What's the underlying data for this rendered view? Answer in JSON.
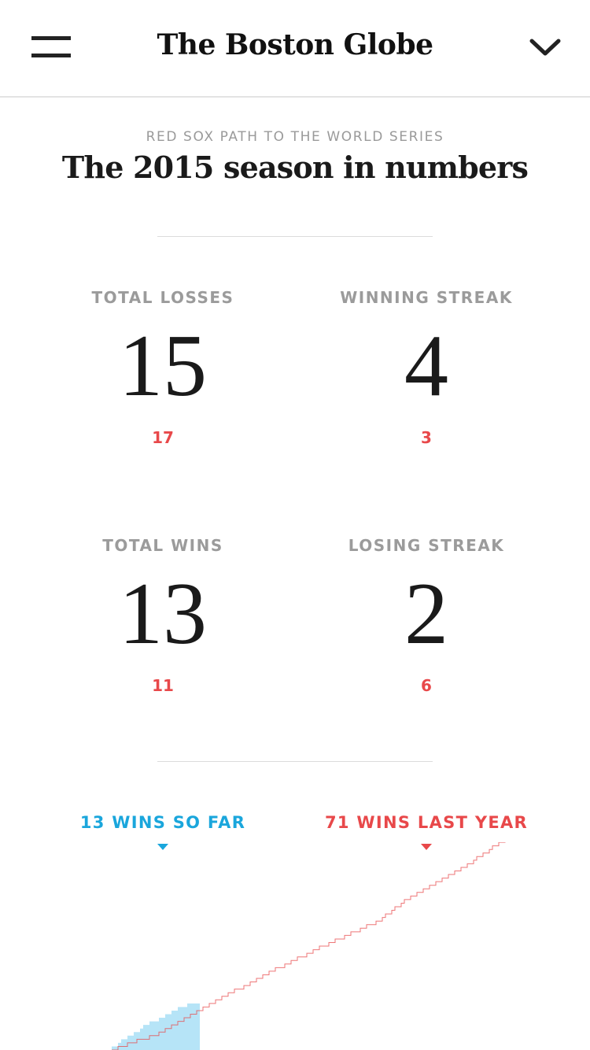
{
  "header": {
    "logo_text": "The Boston Globe",
    "menu_icon": "hamburger-menu-icon",
    "dropdown_icon": "chevron-down-icon"
  },
  "article": {
    "kicker": "RED SOX PATH TO THE WORLD SERIES",
    "title": "The 2015 season in numbers"
  },
  "stats": [
    {
      "label": "TOTAL LOSSES",
      "value": "15",
      "previous": "17"
    },
    {
      "label": "WINNING STREAK",
      "value": "4",
      "previous": "3"
    },
    {
      "label": "TOTAL WINS",
      "value": "13",
      "previous": "11"
    },
    {
      "label": "LOSING STREAK",
      "value": "2",
      "previous": "6"
    }
  ],
  "legend": {
    "current": "13 WINS SO FAR",
    "last_year": "71 WINS LAST YEAR"
  },
  "colors": {
    "current_season": "#1aa6dc",
    "current_fill": "#b6e4f7",
    "last_season": "#e8484a",
    "label_gray": "#9b9b9b"
  },
  "chart_data": {
    "type": "area",
    "series": [
      {
        "name": "13 WINS SO FAR",
        "values": [
          1,
          1,
          2,
          3,
          3,
          4,
          4,
          5,
          5,
          6,
          7,
          7,
          8,
          8,
          8,
          9,
          9,
          10,
          10,
          11,
          11,
          12,
          12,
          12,
          13,
          13,
          13,
          13
        ]
      },
      {
        "name": "71 WINS LAST YEAR",
        "values": [
          0,
          0,
          1,
          1,
          1,
          2,
          2,
          2,
          3,
          3,
          3,
          3,
          4,
          4,
          4,
          5,
          5,
          6,
          6,
          7,
          7,
          8,
          8,
          9,
          9,
          10,
          10,
          11,
          11,
          12,
          12,
          13,
          13,
          14,
          14,
          15,
          15,
          16,
          16,
          17,
          17,
          17,
          18,
          18,
          19,
          19,
          20,
          20,
          21,
          21,
          22,
          22,
          23,
          23,
          23,
          24,
          24,
          25,
          25,
          26,
          26,
          26,
          27,
          27,
          28,
          28,
          29,
          29,
          29,
          30,
          30,
          31,
          31,
          31,
          32,
          32,
          33,
          33,
          33,
          34,
          34,
          35,
          35,
          35,
          36,
          36,
          37,
          38,
          38,
          39,
          40,
          40,
          41,
          42,
          42,
          43,
          43,
          44,
          44,
          45,
          45,
          46,
          46,
          47,
          47,
          48,
          48,
          49,
          49,
          50,
          50,
          51,
          51,
          52,
          52,
          53,
          54,
          54,
          55,
          55,
          56,
          57,
          57,
          58,
          58,
          59,
          60,
          60,
          61,
          61,
          62,
          62,
          63,
          64,
          64,
          65,
          65,
          66,
          67,
          67,
          68,
          68,
          69,
          69,
          70,
          70,
          71,
          71
        ]
      }
    ]
  }
}
